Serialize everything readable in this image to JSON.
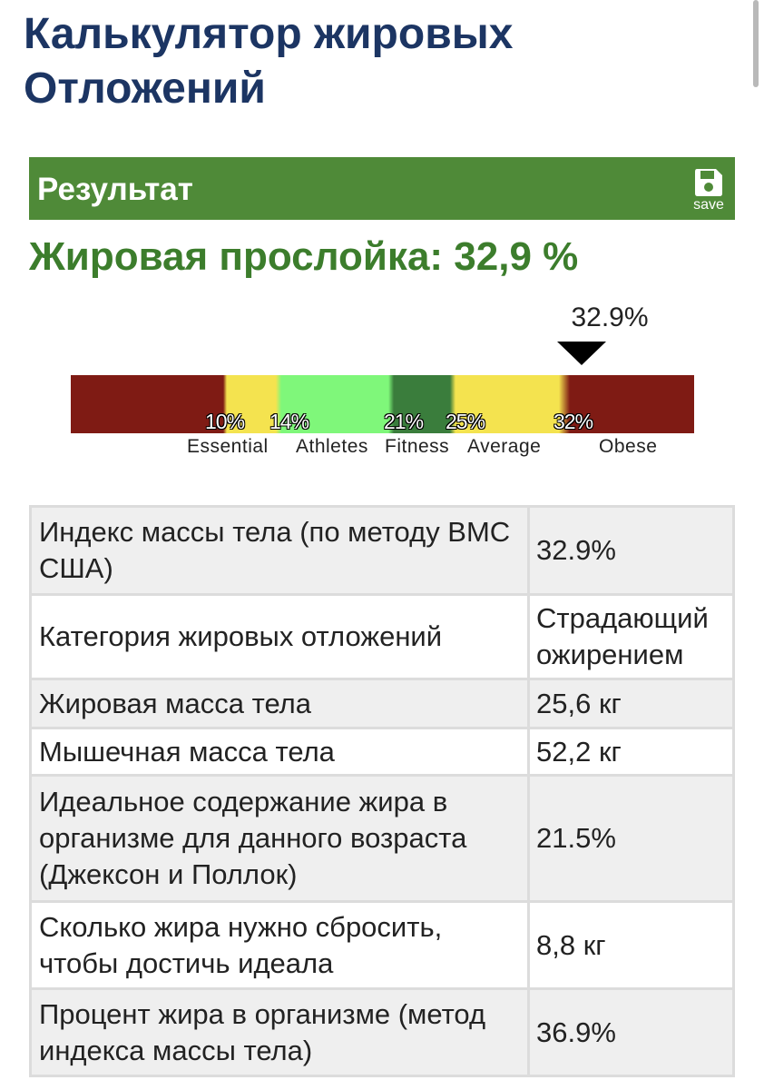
{
  "page": {
    "title": "Калькулятор жировых Отложений"
  },
  "result_panel": {
    "title": "Результат",
    "save_label": "save",
    "save_icon": "floppy-disk-icon",
    "header_color": "#4f8a38"
  },
  "headline": {
    "label": "Жировая прослойка: 32,9 %"
  },
  "scale": {
    "marker_text": "32.9%",
    "marker_value": 32.9,
    "ticks": [
      "10%",
      "14%",
      "21%",
      "25%",
      "32%"
    ],
    "categories": [
      "Essential",
      "Athletes",
      "Fitness",
      "Average",
      "Obese"
    ],
    "segment_colors": {
      "essential": "#7f1b14",
      "athletes_low": "#f4e34f",
      "athletes_high": "#7ff77a",
      "fitness": "#3a7d3c",
      "average": "#f4e34f",
      "obese": "#7f1b14"
    }
  },
  "table": {
    "rows": [
      {
        "label": "Индекс массы тела (по методу ВМС США)",
        "value": "32.9%"
      },
      {
        "label": "Категория жировых отложений",
        "value": "Страдающий ожирением"
      },
      {
        "label": "Жировая масса тела",
        "value": "25,6 кг"
      },
      {
        "label": "Мышечная масса тела",
        "value": "52,2 кг"
      },
      {
        "label": "Идеальное содержание жира в организме для данного возраста (Джексон и Поллок)",
        "value": "21.5%"
      },
      {
        "label": "Сколько жира нужно сбросить, чтобы достичь идеала",
        "value": "8,8 кг"
      },
      {
        "label": "Процент жира в организме (метод индекса массы тела)",
        "value": "36.9%"
      }
    ]
  }
}
